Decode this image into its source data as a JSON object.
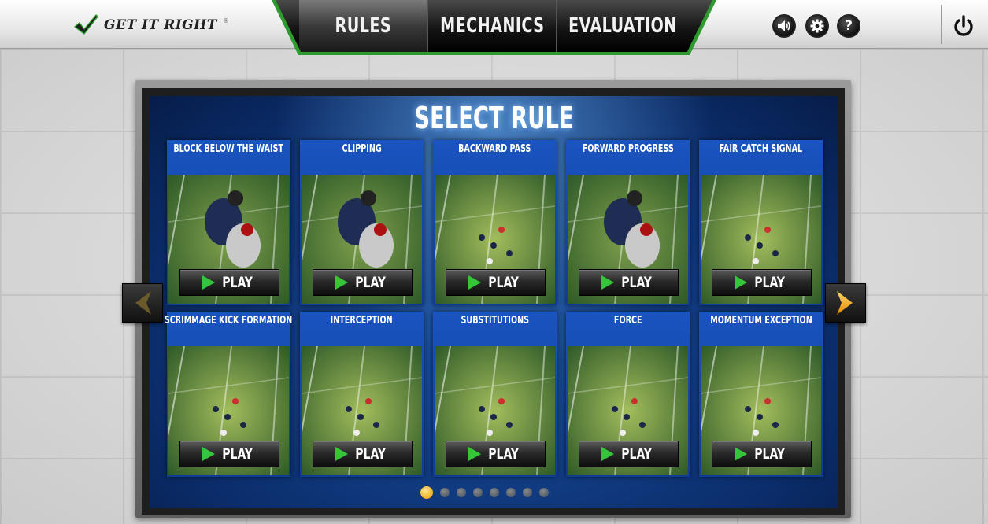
{
  "app": {
    "logo_text": "GET IT RIGHT",
    "logo_mark": "®"
  },
  "tabs": [
    {
      "label": "RULES",
      "active": true
    },
    {
      "label": "MECHANICS",
      "active": false
    },
    {
      "label": "EVALUATION",
      "active": false
    }
  ],
  "header_buttons": {
    "sound_icon": "speaker-icon",
    "settings_icon": "gear-icon",
    "help_label": "?",
    "power_icon": "power-icon"
  },
  "screen": {
    "title": "SELECT RULE"
  },
  "cards": [
    {
      "title": "BLOCK BELOW THE WAIST",
      "play": "PLAY"
    },
    {
      "title": "CLIPPING",
      "play": "PLAY"
    },
    {
      "title": "BACKWARD PASS",
      "play": "PLAY"
    },
    {
      "title": "FORWARD PROGRESS",
      "play": "PLAY"
    },
    {
      "title": "FAIR CATCH SIGNAL",
      "play": "PLAY"
    },
    {
      "title": "SCRIMMAGE KICK FORMATION",
      "play": "PLAY"
    },
    {
      "title": "INTERCEPTION",
      "play": "PLAY"
    },
    {
      "title": "SUBSTITUTIONS",
      "play": "PLAY"
    },
    {
      "title": "FORCE",
      "play": "PLAY"
    },
    {
      "title": "MOMENTUM EXCEPTION",
      "play": "PLAY"
    }
  ],
  "pagination": {
    "count": 8,
    "active_index": 0
  },
  "colors": {
    "accent_green": "#2e9b2e",
    "play_green": "#35c43a",
    "arrow_gold": "#f0a91a",
    "panel_blue": "#0f3c95"
  }
}
